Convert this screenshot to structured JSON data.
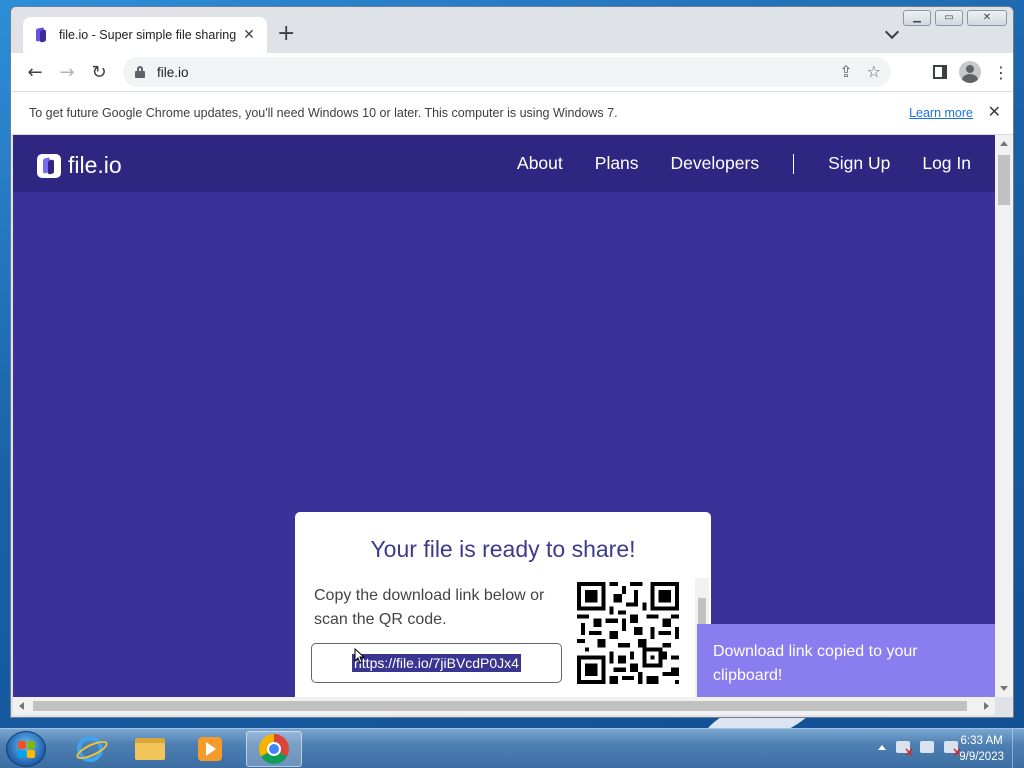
{
  "browser": {
    "tab_title": "file.io - Super simple file sharing",
    "url": "file.io"
  },
  "infobar": {
    "message": "To get future Google Chrome updates, you'll need Windows 10 or later. This computer is using Windows 7.",
    "learn_more": "Learn more"
  },
  "site": {
    "logo_text": "file.io",
    "nav": [
      "About",
      "Plans",
      "Developers",
      "Sign Up",
      "Log In"
    ]
  },
  "card": {
    "title": "Your file is ready to share!",
    "description": "Copy the download link below or scan the QR code.",
    "link": "https://file.io/7jiBVcdP0Jx4"
  },
  "toast": {
    "message": "Download link copied to your clipboard!"
  },
  "taskbar": {
    "time": "6:33 AM",
    "date": "9/9/2023"
  },
  "colors": {
    "page_bg": "#3b3299",
    "nav_bg": "#2e2680",
    "title_color": "#3d3a8c",
    "toast_bg": "#8a7df0"
  }
}
